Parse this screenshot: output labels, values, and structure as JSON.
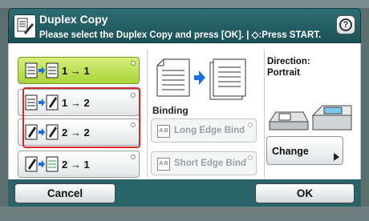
{
  "header": {
    "title": "Duplex Copy",
    "subtitle": "Please select the Duplex Copy and press [OK]. | ◇:Press START.",
    "help_label": "?"
  },
  "options": [
    {
      "label": "1 → 1",
      "selected": true
    },
    {
      "label": "1 → 2",
      "selected": false
    },
    {
      "label": "2 → 2",
      "selected": false
    },
    {
      "label": "2 → 1",
      "selected": false
    }
  ],
  "binding": {
    "title": "Binding",
    "long_edge": "Long Edge Bind",
    "short_edge": "Short Edge Bind",
    "long_icon": "A B",
    "short_icon": "A B"
  },
  "direction": {
    "label": "Direction:",
    "value": "Portrait"
  },
  "change_label": "Change",
  "footer": {
    "cancel": "Cancel",
    "ok": "OK"
  },
  "colors": {
    "header": "#1c5258",
    "selected": "#b5dc4a",
    "highlight": "#d22a2a",
    "arrow": "#1e6fd9"
  }
}
